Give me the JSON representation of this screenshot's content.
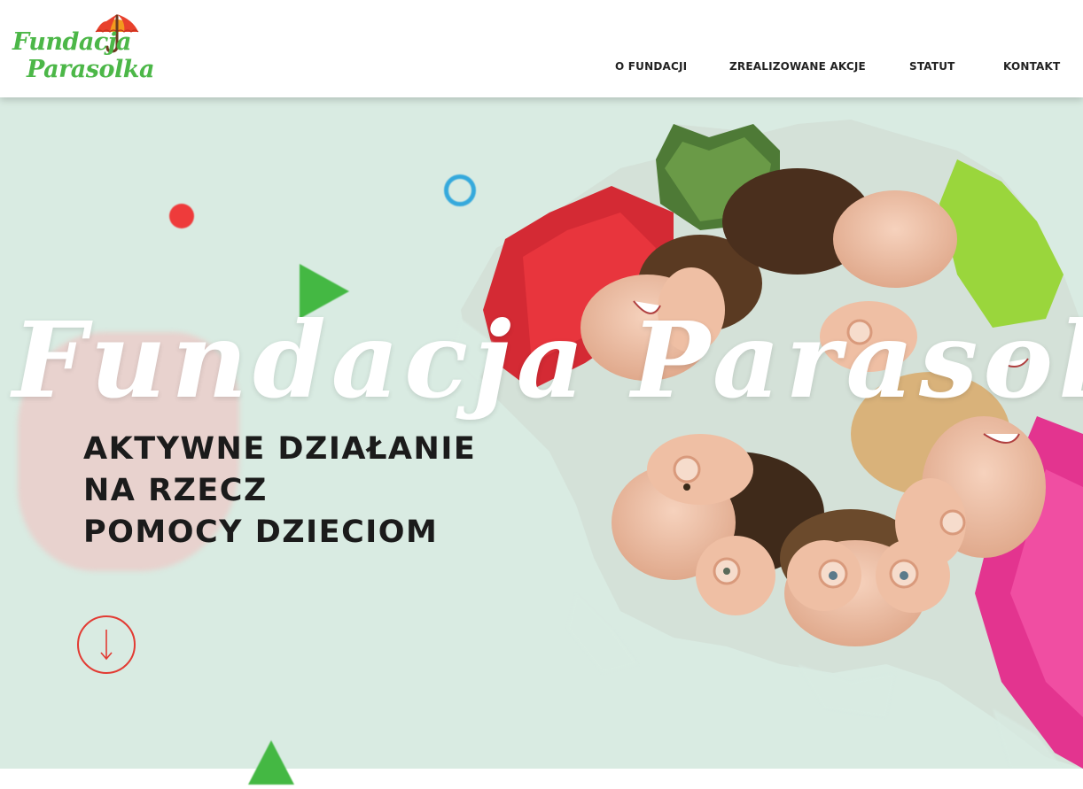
{
  "logo": {
    "line1": "Fundacja",
    "line2": "Parasolka",
    "icon": "umbrella-icon",
    "color": "#4cb748"
  },
  "nav": {
    "items": [
      {
        "label": "O FUNDACJI"
      },
      {
        "label": "ZREALIZOWANE AKCJE"
      },
      {
        "label": "STATUT"
      },
      {
        "label": "KONTAKT"
      }
    ]
  },
  "hero": {
    "title": "Fundacja Parasolka",
    "subtitle": [
      "AKTYWNE DZIAŁANIE",
      "NA RZECZ",
      "POMOCY DZIECIOM"
    ],
    "scroll_icon": "arrow-down-icon",
    "background": "#d9ebe2",
    "accent_red": "#ee3b3b",
    "accent_blue": "#35a9dc",
    "accent_green": "#44b843"
  }
}
